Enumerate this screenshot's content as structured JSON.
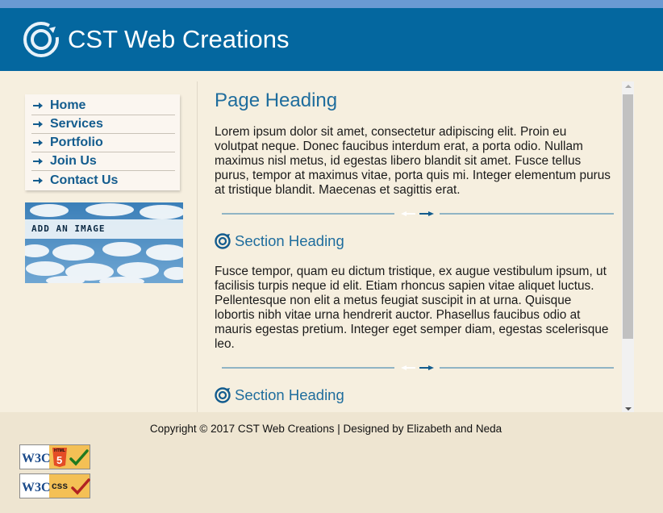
{
  "header": {
    "site_title": "CST Web Creations"
  },
  "nav": {
    "items": [
      {
        "label": "Home"
      },
      {
        "label": "Services"
      },
      {
        "label": "Portfolio"
      },
      {
        "label": "Join Us"
      },
      {
        "label": "Contact Us"
      }
    ]
  },
  "sidebar": {
    "ad_text": "ADD AN IMAGE"
  },
  "main": {
    "page_heading": "Page Heading",
    "paragraph_1": "Lorem ipsum dolor sit amet, consectetur adipiscing elit. Proin eu volutpat neque. Donec faucibus interdum erat, a porta odio. Nullam maximus nisl metus, id egestas libero blandit sit amet. Fusce tellus purus, tempor at maximus vitae, porta quis mi. Integer elementum purus at tristique blandit. Maecenas et sagittis erat.",
    "section_1_heading": "Section Heading",
    "paragraph_2": "Fusce tempor, quam eu dictum tristique, ex augue vestibulum ipsum, ut facilisis turpis neque id elit. Etiam rhoncus sapien vitae aliquet luctus. Pellentesque non elit a metus feugiat suscipit in at urna. Quisque lobortis nibh vitae urna hendrerit auctor. Phasellus faucibus odio at mauris egestas pretium. Integer eget semper diam, egestas scelerisque leo.",
    "section_2_heading": "Section Heading"
  },
  "footer": {
    "copyright": "Copyright © 2017 CST Web Creations  |  Designed by Elizabeth and Neda",
    "badge_html5": {
      "w3c": "W3C",
      "label": "HTML",
      "number": "5"
    },
    "badge_css": {
      "w3c": "W3C",
      "label": "css"
    }
  },
  "colors": {
    "header_blue": "#04679f",
    "top_strip": "#6a9ad3",
    "heading_blue": "#1f6d9d",
    "page_bg": "#f6efdf",
    "footer_bg": "#eee5d1"
  },
  "icons": {
    "logo": "swirl-logo-icon",
    "nav_arrow": "arrow-right-icon",
    "section": "swirl-icon",
    "separator": "arrow-pair-icon"
  }
}
